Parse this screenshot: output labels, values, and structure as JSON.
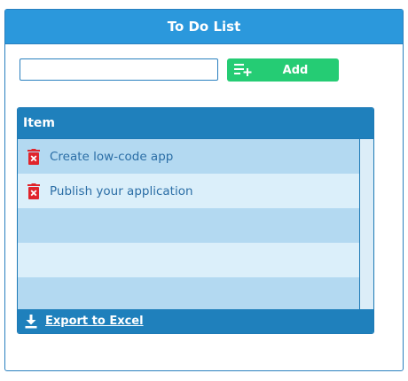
{
  "panel": {
    "title": "To Do List"
  },
  "new_item": {
    "value": "",
    "placeholder": ""
  },
  "add_button": {
    "label": "Add",
    "icon": "playlist-add-icon"
  },
  "grid": {
    "column_header": "Item",
    "rows": [
      {
        "text": "Create low-code app",
        "icon": "delete-icon"
      },
      {
        "text": "Publish your application",
        "icon": "delete-icon"
      },
      {
        "text": ""
      },
      {
        "text": ""
      },
      {
        "text": ""
      }
    ],
    "export_label": "Export to Excel",
    "export_icon": "download-icon"
  },
  "colors": {
    "header": "#2b98dc",
    "grid_header": "#1f80bc",
    "add_button": "#25cc74",
    "row_odd": "#b3d9f1",
    "row_even": "#dbeffa",
    "delete_icon": "#e0242b",
    "text": "#2b6ea6"
  }
}
